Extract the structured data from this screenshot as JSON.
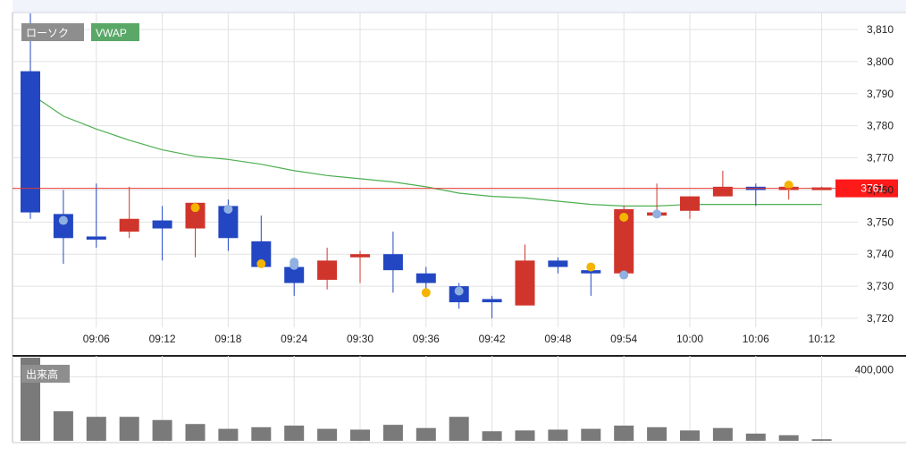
{
  "chart_data": [
    {
      "type": "candlestick",
      "legend": [
        "ローソク",
        "VWAP"
      ],
      "colors": {
        "up": "#d0352b",
        "down": "#2347c2",
        "vwap": "#4caf50",
        "current_price_line": "#e53935",
        "current_price_badge": "#ff1a1a",
        "marker_yellow": "#f4b400",
        "marker_lightblue": "#8fb0e0"
      },
      "x_ticks": [
        "09:06",
        "09:12",
        "09:18",
        "09:24",
        "09:30",
        "09:36",
        "09:42",
        "09:48",
        "09:54",
        "10:00",
        "10:06",
        "10:12"
      ],
      "y_ticks": [
        "3,720",
        "3,730",
        "3,740",
        "3,750",
        "3,760",
        "3,770",
        "3,780",
        "3,790",
        "3,800",
        "3,810"
      ],
      "ylim": [
        3717,
        3814
      ],
      "current_price": 3760.5,
      "current_price_label": "3761",
      "candles": [
        {
          "t": 0,
          "o": 3797,
          "h": 3815,
          "l": 3751,
          "c": 3753
        },
        {
          "t": 1,
          "o": 3752.5,
          "h": 3760,
          "l": 3737,
          "c": 3745
        },
        {
          "t": 2,
          "o": 3745.5,
          "h": 3762,
          "l": 3742,
          "c": 3744.5
        },
        {
          "t": 3,
          "o": 3747,
          "h": 3761,
          "l": 3745,
          "c": 3751
        },
        {
          "t": 4,
          "o": 3750.5,
          "h": 3755,
          "l": 3738,
          "c": 3748
        },
        {
          "t": 5,
          "o": 3748,
          "h": 3756,
          "l": 3739,
          "c": 3756
        },
        {
          "t": 6,
          "o": 3755,
          "h": 3757,
          "l": 3741,
          "c": 3745
        },
        {
          "t": 7,
          "o": 3744,
          "h": 3752,
          "l": 3736,
          "c": 3736
        },
        {
          "t": 8,
          "o": 3736,
          "h": 3738,
          "l": 3727,
          "c": 3731
        },
        {
          "t": 9,
          "o": 3732,
          "h": 3742,
          "l": 3729,
          "c": 3738
        },
        {
          "t": 10,
          "o": 3739,
          "h": 3741,
          "l": 3731,
          "c": 3740
        },
        {
          "t": 11,
          "o": 3740,
          "h": 3747,
          "l": 3728,
          "c": 3735
        },
        {
          "t": 12,
          "o": 3734,
          "h": 3736,
          "l": 3728,
          "c": 3731
        },
        {
          "t": 13,
          "o": 3730,
          "h": 3731,
          "l": 3723,
          "c": 3725
        },
        {
          "t": 14,
          "o": 3726,
          "h": 3727,
          "l": 3720,
          "c": 3725
        },
        {
          "t": 15,
          "o": 3724,
          "h": 3743,
          "l": 3724,
          "c": 3738
        },
        {
          "t": 16,
          "o": 3738,
          "h": 3739,
          "l": 3734,
          "c": 3736
        },
        {
          "t": 17,
          "o": 3735,
          "h": 3735,
          "l": 3727,
          "c": 3734
        },
        {
          "t": 18,
          "o": 3734,
          "h": 3755,
          "l": 3734,
          "c": 3754
        },
        {
          "t": 19,
          "o": 3752,
          "h": 3762,
          "l": 3752,
          "c": 3753
        },
        {
          "t": 20,
          "o": 3753.5,
          "h": 3758,
          "l": 3751,
          "c": 3758
        },
        {
          "t": 21,
          "o": 3758,
          "h": 3766,
          "l": 3758,
          "c": 3761
        },
        {
          "t": 22,
          "o": 3761,
          "h": 3762,
          "l": 3755,
          "c": 3760
        },
        {
          "t": 23,
          "o": 3760,
          "h": 3762,
          "l": 3757,
          "c": 3761
        },
        {
          "t": 24,
          "o": 3760.5,
          "h": 3761,
          "l": 3760,
          "c": 3760.8
        }
      ],
      "vwap": [
        {
          "t": 0,
          "v": 3790
        },
        {
          "t": 1,
          "v": 3783
        },
        {
          "t": 2,
          "v": 3779
        },
        {
          "t": 3,
          "v": 3775.5
        },
        {
          "t": 4,
          "v": 3772.5
        },
        {
          "t": 5,
          "v": 3770.5
        },
        {
          "t": 6,
          "v": 3769.5
        },
        {
          "t": 7,
          "v": 3768
        },
        {
          "t": 8,
          "v": 3766
        },
        {
          "t": 9,
          "v": 3764.5
        },
        {
          "t": 10,
          "v": 3763.5
        },
        {
          "t": 11,
          "v": 3762.5
        },
        {
          "t": 12,
          "v": 3761
        },
        {
          "t": 13,
          "v": 3759
        },
        {
          "t": 14,
          "v": 3758
        },
        {
          "t": 15,
          "v": 3757.5
        },
        {
          "t": 16,
          "v": 3756.5
        },
        {
          "t": 17,
          "v": 3755.5
        },
        {
          "t": 18,
          "v": 3755
        },
        {
          "t": 19,
          "v": 3755
        },
        {
          "t": 20,
          "v": 3755.5
        },
        {
          "t": 21,
          "v": 3755.5
        },
        {
          "t": 22,
          "v": 3755.5
        },
        {
          "t": 23,
          "v": 3755.5
        },
        {
          "t": 24,
          "v": 3755.5
        }
      ],
      "markers": [
        {
          "t": 1,
          "v": 3750.5,
          "color": "lightblue"
        },
        {
          "t": 5,
          "v": 3754.5,
          "color": "yellow"
        },
        {
          "t": 6,
          "v": 3754,
          "color": "lightblue"
        },
        {
          "t": 7,
          "v": 3737,
          "color": "yellow"
        },
        {
          "t": 8,
          "v": 3737.5,
          "color": "lightblue"
        },
        {
          "t": 8,
          "v": 3736.5,
          "color": "lightblue"
        },
        {
          "t": 12,
          "v": 3728,
          "color": "yellow"
        },
        {
          "t": 13,
          "v": 3728.5,
          "color": "lightblue"
        },
        {
          "t": 17,
          "v": 3736,
          "color": "yellow"
        },
        {
          "t": 18,
          "v": 3751.5,
          "color": "yellow"
        },
        {
          "t": 18,
          "v": 3733.5,
          "color": "lightblue"
        },
        {
          "t": 19,
          "v": 3752.5,
          "color": "lightblue"
        },
        {
          "t": 23,
          "v": 3761.5,
          "color": "yellow"
        }
      ]
    },
    {
      "type": "bar",
      "title": "出来高",
      "y_ticks": [
        "400,000"
      ],
      "ylim": [
        0,
        520000
      ],
      "values": [
        520000,
        185000,
        150000,
        150000,
        130000,
        105000,
        75000,
        85000,
        95000,
        75000,
        70000,
        100000,
        80000,
        150000,
        60000,
        65000,
        70000,
        75000,
        95000,
        85000,
        65000,
        80000,
        45000,
        35000,
        10000
      ]
    }
  ]
}
